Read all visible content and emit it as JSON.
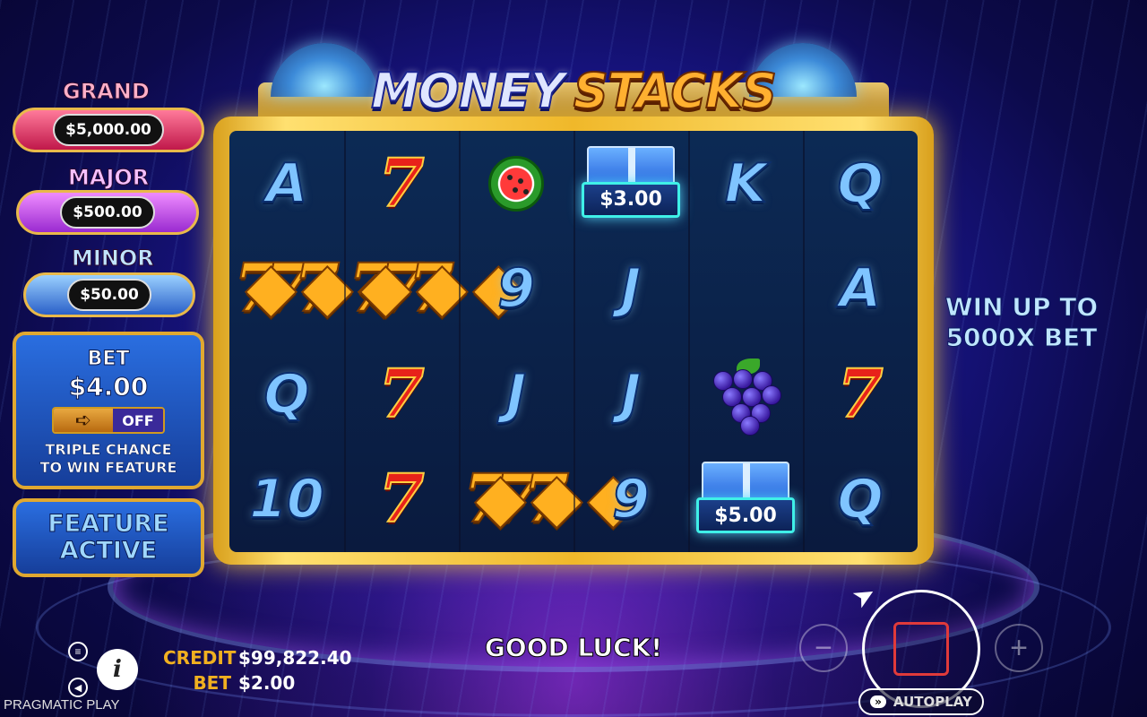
{
  "game": {
    "logo_word1": "MONEY",
    "logo_word2": "STACKS"
  },
  "jackpots": {
    "grand": {
      "label": "GRAND",
      "value": "$5,000.00",
      "color": "#c0184a"
    },
    "major": {
      "label": "MAJOR",
      "value": "$500.00",
      "color": "#9a2ad0"
    },
    "minor": {
      "label": "MINOR",
      "value": "$50.00",
      "color": "#2a60c8"
    }
  },
  "bet_panel": {
    "label": "BET",
    "value": "$4.00",
    "toggle_state": "OFF",
    "feature_line1": "TRIPLE CHANCE",
    "feature_line2": "TO WIN FEATURE"
  },
  "feature_button": {
    "line1": "FEATURE",
    "line2": "ACTIVE"
  },
  "promo": {
    "line1": "WIN UP TO",
    "line2": "5000X BET"
  },
  "reels": {
    "grid": [
      [
        {
          "type": "letter",
          "text": "A"
        },
        {
          "type": "seven",
          "text": "7"
        },
        {
          "type": "melon",
          "icon": "watermelon-icon"
        },
        {
          "type": "cash",
          "text": "$3.00"
        },
        {
          "type": "letter",
          "text": "K"
        },
        {
          "type": "letter",
          "text": "Q"
        }
      ],
      [
        {
          "type": "triple",
          "text": "777"
        },
        {
          "type": "triple",
          "text": "777"
        },
        {
          "type": "letter",
          "text": "9"
        },
        {
          "type": "letter",
          "text": "J"
        },
        {
          "type": "empty",
          "text": ""
        },
        {
          "type": "letter",
          "text": "A"
        }
      ],
      [
        {
          "type": "letter",
          "text": "Q"
        },
        {
          "type": "seven",
          "text": "7"
        },
        {
          "type": "letter",
          "text": "J"
        },
        {
          "type": "letter",
          "text": "J"
        },
        {
          "type": "grapes",
          "icon": "grapes-icon"
        },
        {
          "type": "seven",
          "text": "7"
        }
      ],
      [
        {
          "type": "letter",
          "text": "10"
        },
        {
          "type": "seven",
          "text": "7"
        },
        {
          "type": "triple",
          "text": "777"
        },
        {
          "type": "letter",
          "text": "9"
        },
        {
          "type": "cash",
          "text": "$5.00"
        },
        {
          "type": "letter",
          "text": "Q"
        }
      ]
    ]
  },
  "status": {
    "message": "GOOD LUCK!",
    "credit_label": "CREDIT",
    "credit_value": "$99,822.40",
    "bet_label": "BET",
    "bet_value": "$2.00"
  },
  "controls": {
    "minus": "−",
    "plus": "+",
    "autoplay_label": "AUTOPLAY",
    "autoplay_icon": "»",
    "info": "i",
    "menu_icon": "≡",
    "sound_icon": "◀"
  },
  "brand": "PRAGMATIC PLAY"
}
